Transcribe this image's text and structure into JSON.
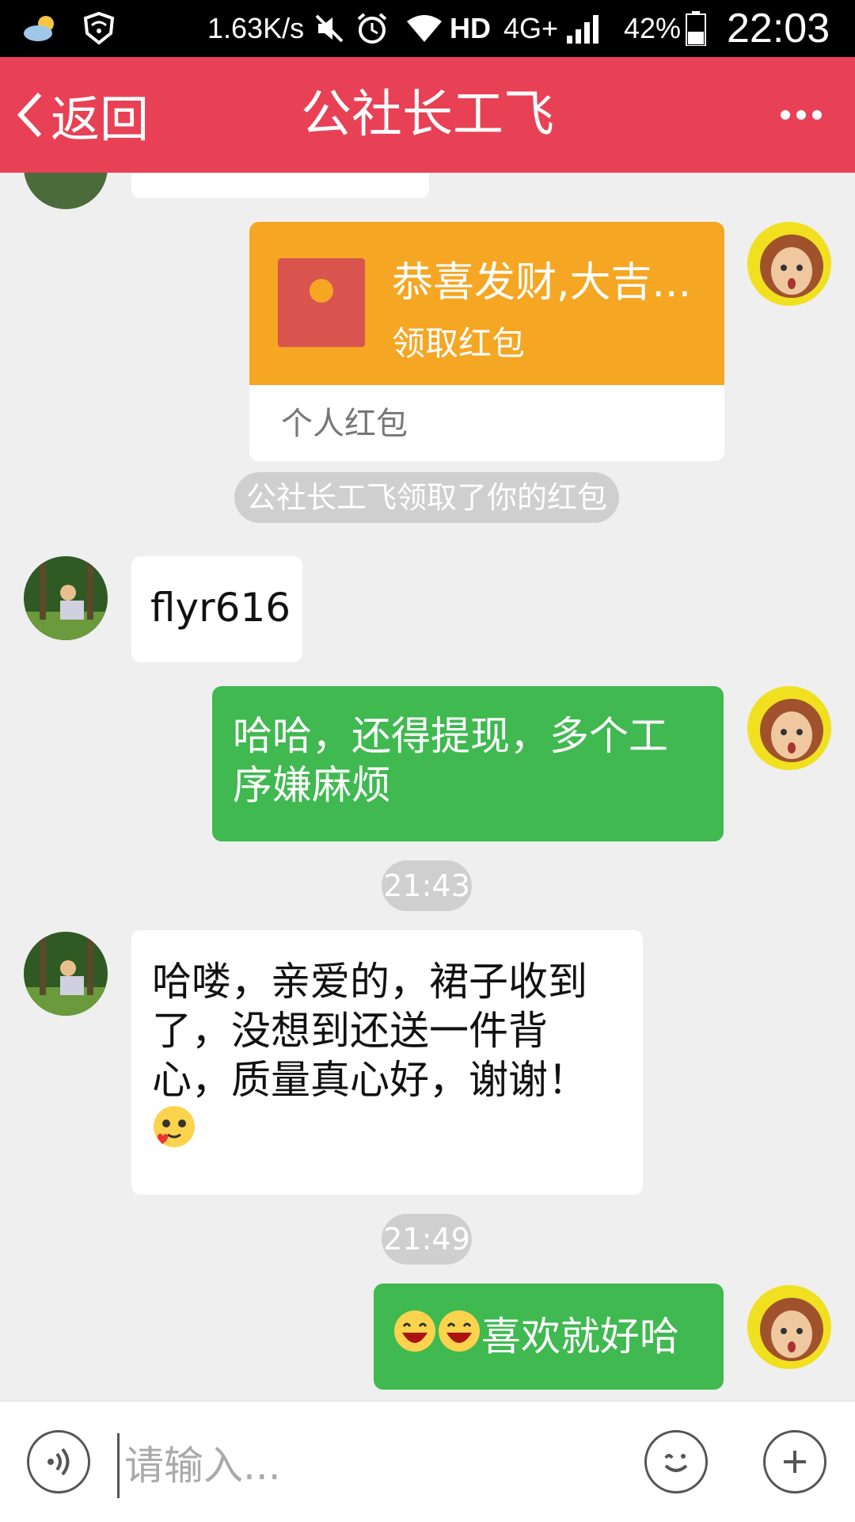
{
  "status_bar": {
    "net_speed": "1.63K/s",
    "network": "HD",
    "network_type": "4G+",
    "battery": "42%",
    "time": "22:03",
    "icons": [
      "weather-icon",
      "wifi-shield-icon",
      "mute-icon",
      "alarm-icon",
      "wifi-icon",
      "signal-icon",
      "battery-icon"
    ]
  },
  "nav": {
    "back_label": "返回",
    "title": "公社长工飞",
    "more_icon": "more-icon"
  },
  "messages": {
    "red_packet": {
      "title": "恭喜发财,大吉...",
      "action": "领取红包",
      "footer": "个人红包"
    },
    "system_notice": "公社长工飞领取了你的红包",
    "msg1": "flyr616",
    "msg2": "哈哈，还得提现，多个工序嫌麻烦",
    "time1": "21:43",
    "msg3": "哈喽，亲爱的，裙子收到了，没想到还送一件背心，质量真心好，谢谢！",
    "time2": "21:49",
    "msg4": "喜欢就好哈"
  },
  "input": {
    "placeholder": "请输入..."
  },
  "colors": {
    "nav_bg": "#e84155",
    "green_bubble": "#3fb950",
    "red_packet": "#f5a623"
  }
}
